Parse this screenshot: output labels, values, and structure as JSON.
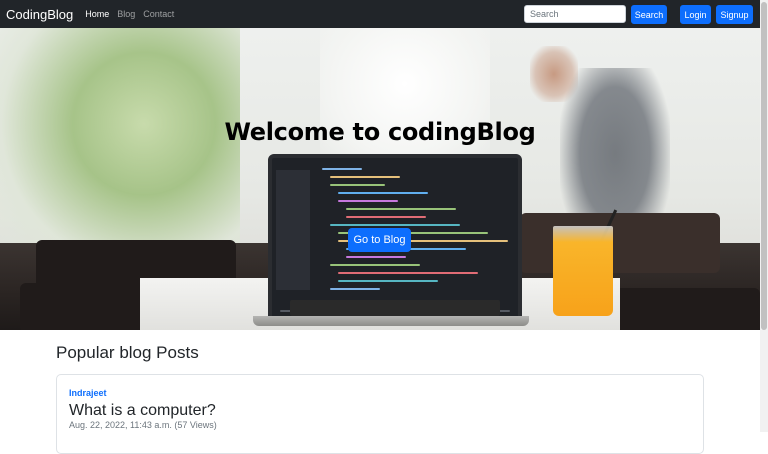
{
  "navbar": {
    "brand": "CodingBlog",
    "links": [
      {
        "label": "Home",
        "active": true
      },
      {
        "label": "Blog",
        "active": false
      },
      {
        "label": "Contact",
        "active": false
      }
    ],
    "search_placeholder": "Search",
    "search_button": "Search",
    "login_button": "Login",
    "signup_button": "Signup"
  },
  "hero": {
    "title": "Welcome to codingBlog",
    "cta_label": "Go to Blog"
  },
  "main": {
    "section_title": "Popular blog Posts",
    "posts": [
      {
        "author": "Indrajeet",
        "title": "What is a computer?",
        "meta": "Aug. 22, 2022, 11:43 a.m. (57 Views)"
      }
    ]
  },
  "colors": {
    "navbar_bg": "#212529",
    "primary": "#0d6efd"
  }
}
